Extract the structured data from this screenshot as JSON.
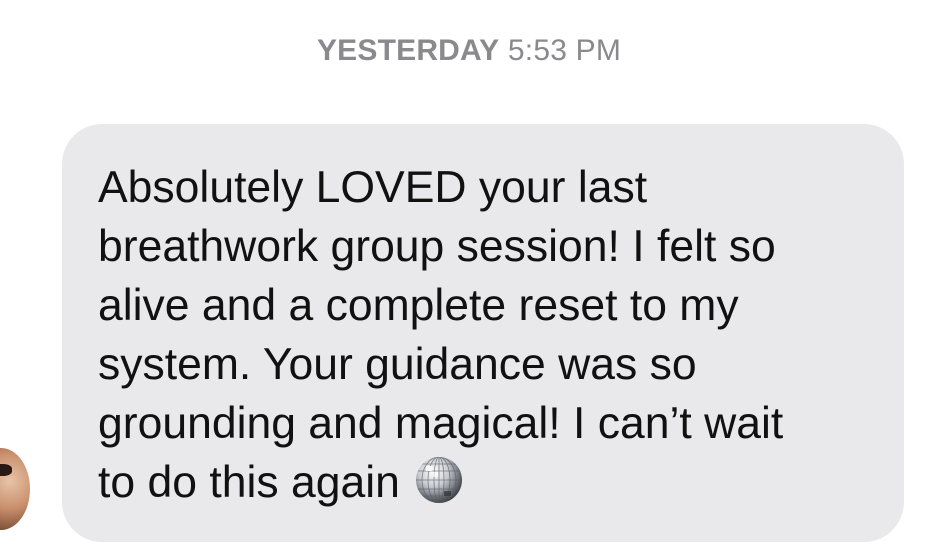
{
  "conversation": {
    "timestamp_day": "YESTERDAY",
    "timestamp_time": "5:53 PM"
  },
  "message": {
    "lines": [
      "Absolutely LOVED your last",
      "breathwork group session! I felt so",
      "alive and a complete reset to my",
      "system. Your guidance was so",
      "grounding and magical! I can’t wait",
      "to do this again"
    ],
    "emoji_icon": "mirror-ball-icon"
  },
  "colors": {
    "bubble_background": "#e9e9eb",
    "timestamp_text": "#8a8a8e",
    "message_text": "#111111"
  }
}
